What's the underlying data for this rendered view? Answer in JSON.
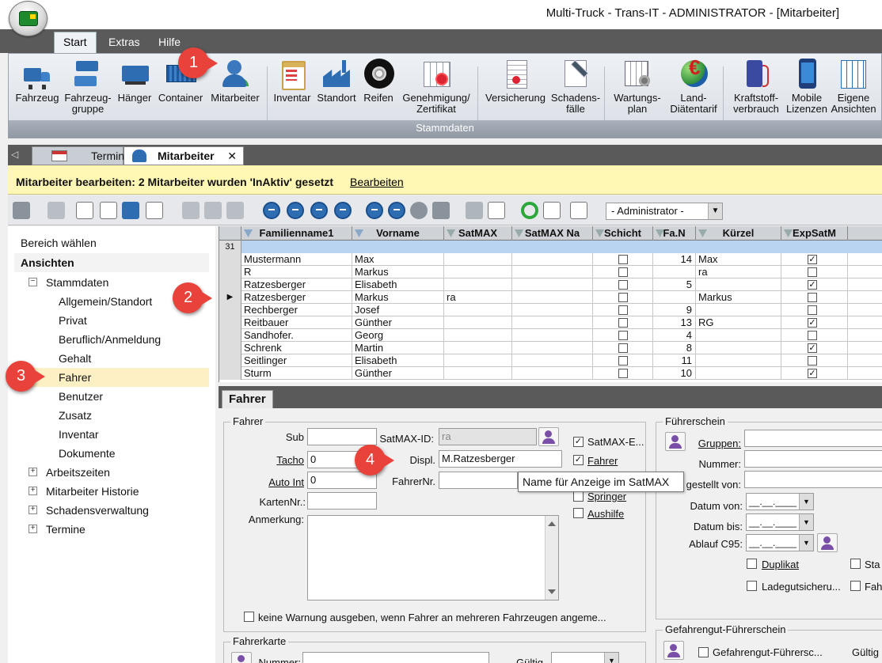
{
  "window": {
    "title": "Multi-Truck - Trans-IT - ADMINISTRATOR -  [Mitarbeiter]"
  },
  "ribbon": {
    "tabs": [
      "Start",
      "Extras",
      "Hilfe"
    ],
    "group_label": "Stammdaten",
    "buttons": [
      {
        "label": "Fahrzeug",
        "icon": "truck-icon"
      },
      {
        "label": "Fahrzeug-\ngruppe",
        "icon": "truck-group-icon"
      },
      {
        "label": "Hänger",
        "icon": "trailer-icon"
      },
      {
        "label": "Container",
        "icon": "container-icon"
      },
      {
        "label": "Mitarbeiter",
        "icon": "employee-icon"
      },
      {
        "label": "Inventar",
        "icon": "clipboard-icon"
      },
      {
        "label": "Standort",
        "icon": "factory-icon"
      },
      {
        "label": "Reifen",
        "icon": "tire-icon"
      },
      {
        "label": "Genehmigung/\nZertifikat",
        "icon": "certificate-icon"
      },
      {
        "label": "Versicherung",
        "icon": "document-icon"
      },
      {
        "label": "Schadens-\nfälle",
        "icon": "tools-icon"
      },
      {
        "label": "Wartungs-\nplan",
        "icon": "maintenance-plan-icon"
      },
      {
        "label": "Land-\nDiätentarif",
        "icon": "globe-euro-icon"
      },
      {
        "label": "Kraftstoff-\nverbrauch",
        "icon": "fuel-icon"
      },
      {
        "label": "Mobile\nLizenzen",
        "icon": "phone-icon"
      },
      {
        "label": "Eigene\nAnsichten",
        "icon": "custom-views-icon"
      }
    ]
  },
  "doc_tabs": {
    "items": [
      "Termine",
      "Mitarbeiter"
    ],
    "close": "✕"
  },
  "info_bar": {
    "message": "Mitarbeiter bearbeiten: 2 Mitarbeiter wurden 'InAktiv' gesetzt",
    "link": "Bearbeiten"
  },
  "toolbar": {
    "selector_value": "- Administrator -"
  },
  "left_nav": {
    "area_label": "Bereich wählen",
    "header": "Ansichten",
    "stammdaten": "Stammdaten",
    "children": [
      "Allgemein/Standort",
      "Privat",
      "Beruflich/Anmeldung",
      "Gehalt",
      "Fahrer",
      "Benutzer",
      "Zusatz",
      "Inventar",
      "Dokumente"
    ],
    "groups": [
      "Arbeitszeiten",
      "Mitarbeiter Historie",
      "Schadensverwaltung",
      "Termine"
    ],
    "plus": "+",
    "minus": "−"
  },
  "grid": {
    "headers": [
      "Familienname1",
      "Vorname",
      "SatMAX",
      "SatMAX Na",
      "Schicht",
      "Fa.N",
      "Kürzel",
      "ExpSatM"
    ],
    "record_count": "31",
    "current_marker": "▶",
    "check_mark": "✓",
    "rows": [
      {
        "last": "Mustermann",
        "first": "Max",
        "satmax": "",
        "fa": "14",
        "kuerzel": "Max",
        "exp": true
      },
      {
        "last": "R",
        "first": "Markus",
        "satmax": "",
        "fa": "",
        "kuerzel": "ra",
        "exp": false
      },
      {
        "last": "Ratzesberger",
        "first": "Elisabeth",
        "satmax": "",
        "fa": "5",
        "kuerzel": "",
        "exp": true
      },
      {
        "last": "Ratzesberger",
        "first": "Markus",
        "satmax": "ra",
        "fa": "",
        "kuerzel": "Markus",
        "exp": false
      },
      {
        "last": "Rechberger",
        "first": "Josef",
        "satmax": "",
        "fa": "9",
        "kuerzel": "",
        "exp": false
      },
      {
        "last": "Reitbauer",
        "first": "Günther",
        "satmax": "",
        "fa": "13",
        "kuerzel": "RG",
        "exp": true
      },
      {
        "last": "Sandhofer.",
        "first": "Georg",
        "satmax": "",
        "fa": "4",
        "kuerzel": "",
        "exp": false
      },
      {
        "last": "Schrenk",
        "first": "Martin",
        "satmax": "",
        "fa": "8",
        "kuerzel": "",
        "exp": true
      },
      {
        "last": "Seitlinger",
        "first": "Elisabeth",
        "satmax": "",
        "fa": "11",
        "kuerzel": "",
        "exp": false
      },
      {
        "last": "Sturm",
        "first": "Günther",
        "satmax": "",
        "fa": "10",
        "kuerzel": "",
        "exp": true
      }
    ]
  },
  "detail": {
    "tab": "Fahrer",
    "fahrer_group": "Fahrer",
    "labels": {
      "sub": "Sub",
      "tacho": "Tacho",
      "auto_int": "Auto Int",
      "kartennr": "KartenNr.:",
      "anmerkung": "Anmerkung:",
      "satmax_id": "SatMAX-ID:",
      "displ": "Displ.",
      "fahrernr": "FahrerNr."
    },
    "values": {
      "sub": "",
      "tacho": "0",
      "auto_int": "0",
      "kartennr": "",
      "satmax_id": "ra",
      "displ": "M.Ratzesberger",
      "fahrernr": ""
    },
    "checks": [
      {
        "label": "SatMAX-E...",
        "checked": true
      },
      {
        "label": "Fahrer",
        "checked": true
      },
      {
        "label": "Springer",
        "checked": false
      },
      {
        "label": "Aushilfe",
        "checked": false
      }
    ],
    "warn_check": "keine Warnung ausgeben, wenn Fahrer an mehreren Fahrzeugen angeme...",
    "tooltip": "Name für Anzeige im SatMAX",
    "fuehrerschein_group": "Führerschein",
    "fs_labels": [
      "Gruppen:",
      "Nummer:",
      "gestellt von:",
      "Datum von:",
      "Datum bis:",
      "Ablauf C95:"
    ],
    "date_placeholder": "__.__.____",
    "fs_checks": [
      "Duplikat",
      "Ladegutsicheru...",
      "Sta",
      "Fah"
    ],
    "fahrerkarte_group": "Fahrerkarte",
    "fahrerkarte_labels": {
      "nummer": "Nummer:",
      "gueltig": "Gültig"
    },
    "gefahrgut_group": "Gefahrengut-Führerschein",
    "gefahrgut_check": "Gefahrengut-Führersc...",
    "gefahrgut_gueltig": "Gültig"
  },
  "callouts": [
    "1",
    "2",
    "3",
    "4"
  ],
  "colors": {
    "info_bar": "#fff7b3",
    "selection": "#fdf0c4",
    "filter_row": "#b9d4f1",
    "callout": "#e8423a"
  }
}
